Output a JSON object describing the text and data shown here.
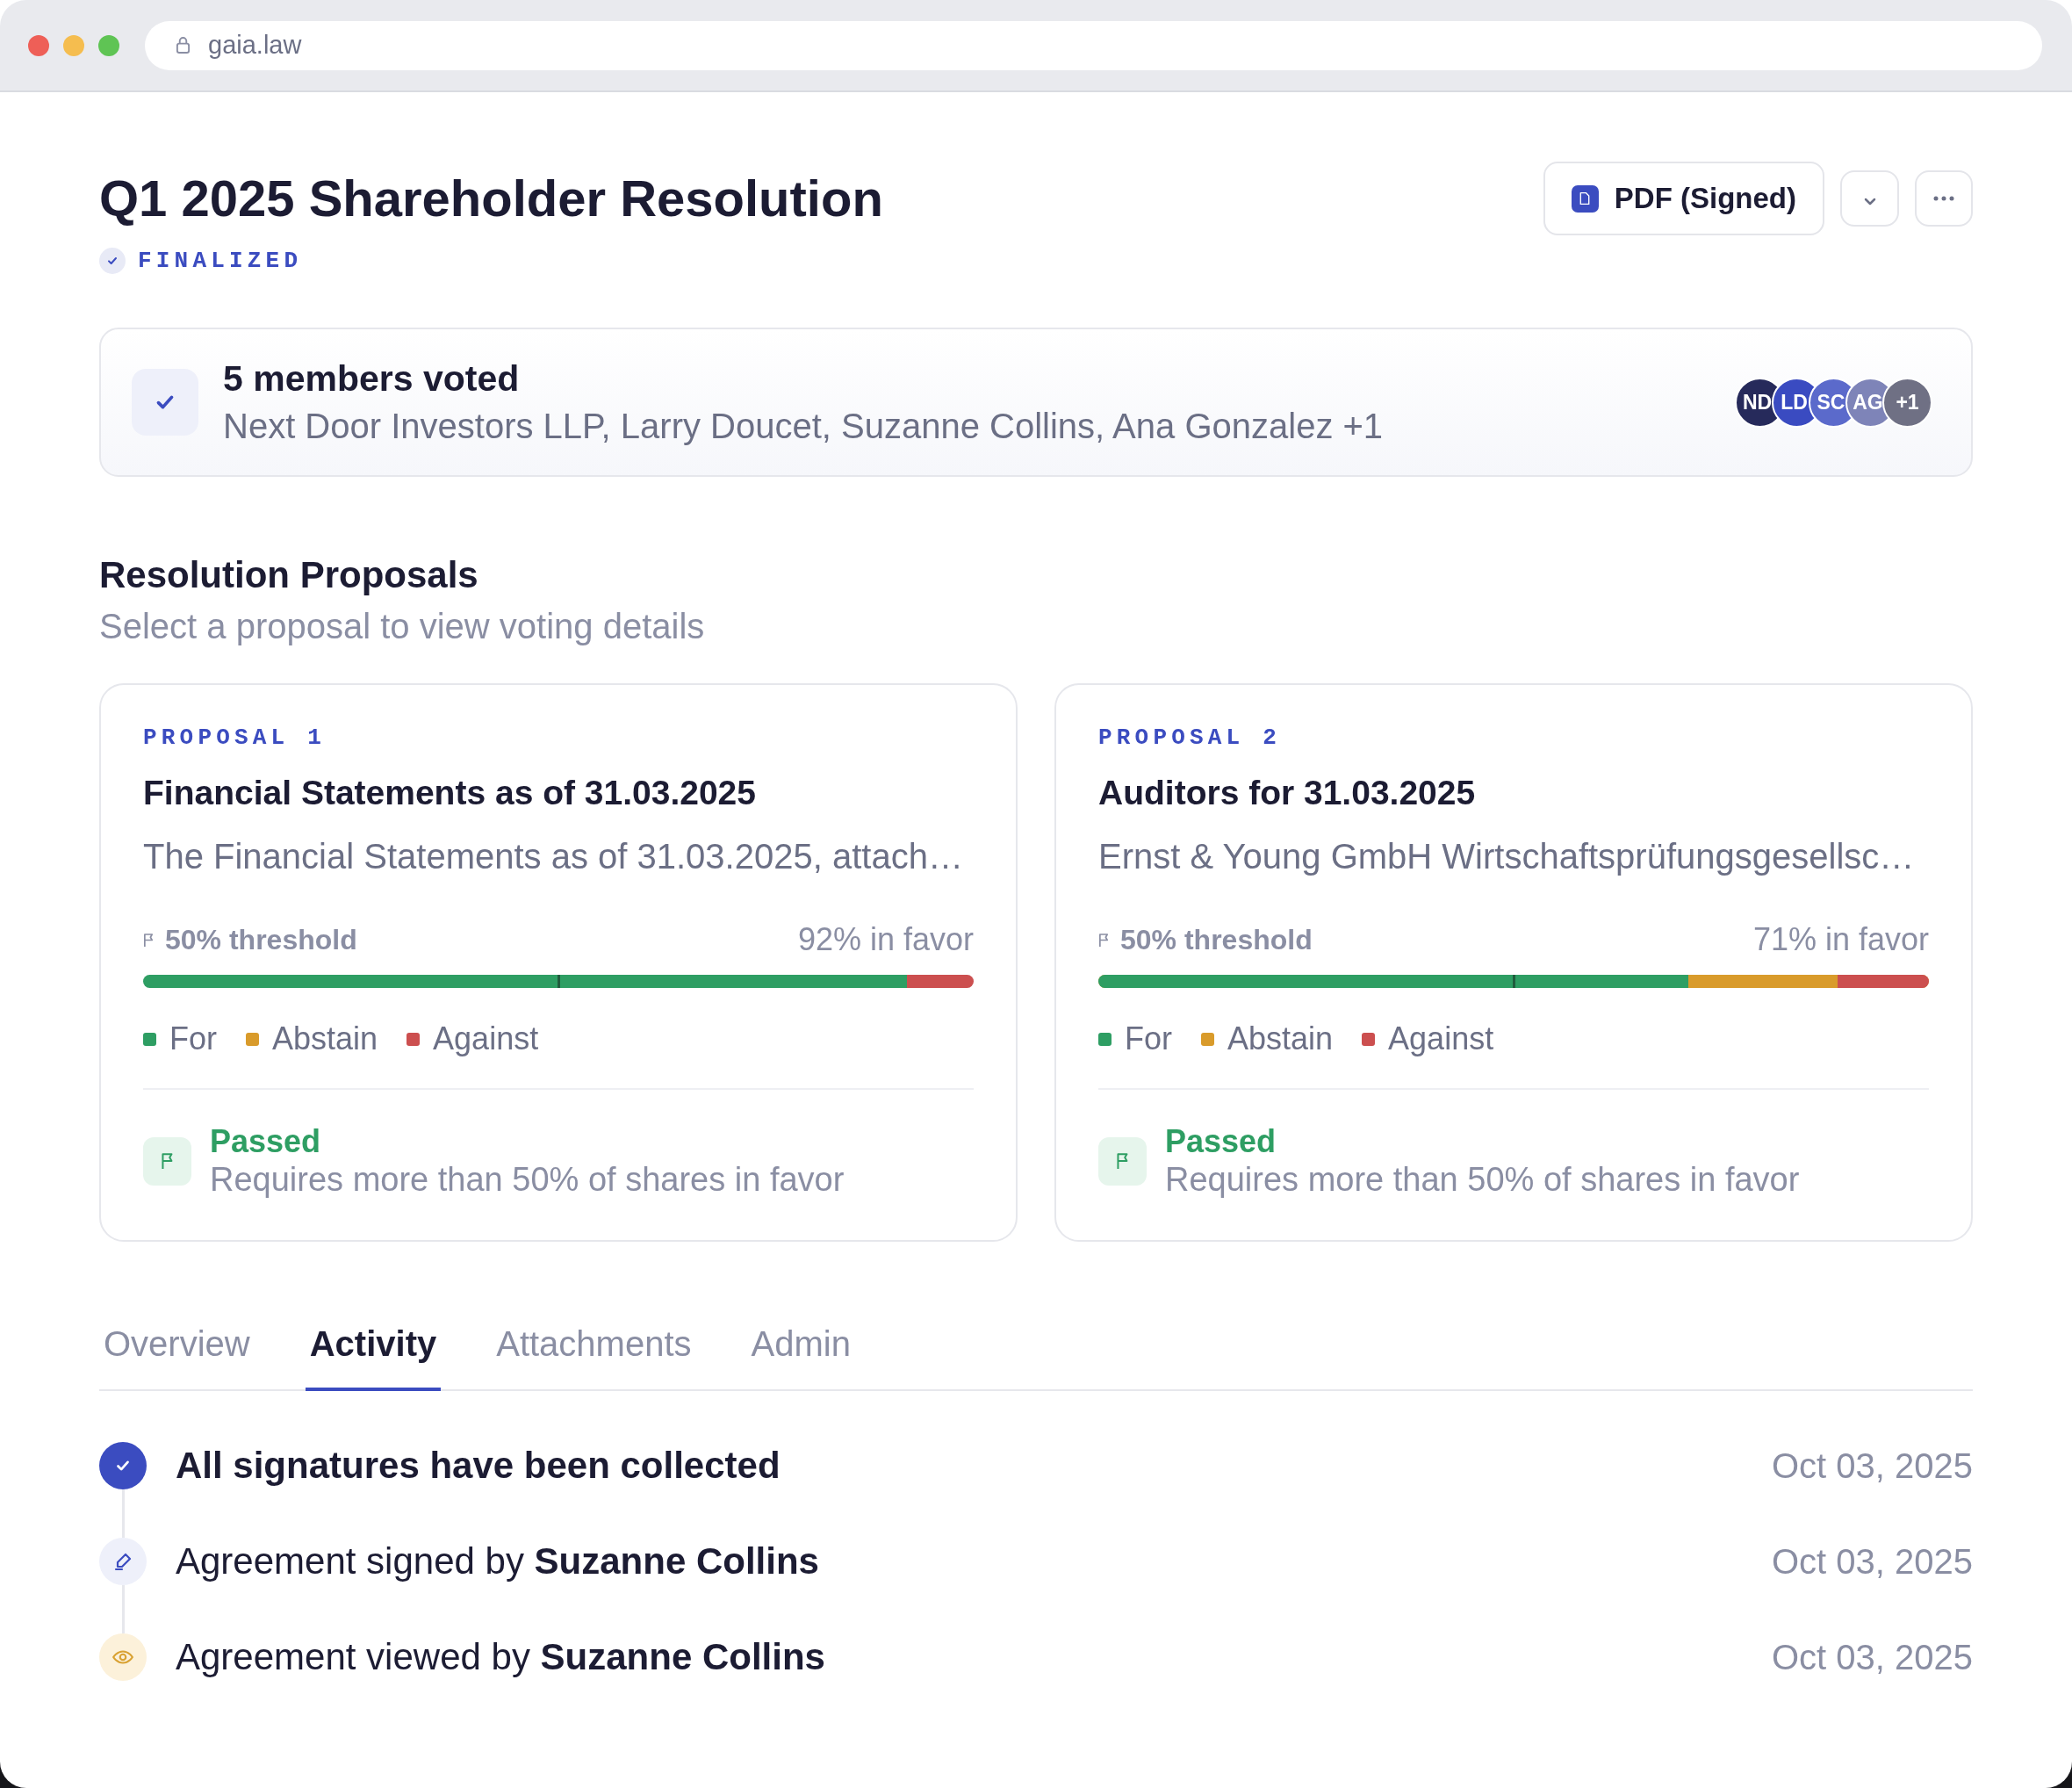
{
  "browser": {
    "url": "gaia.law"
  },
  "header": {
    "title": "Q1 2025 Shareholder Resolution",
    "status": "FINALIZED",
    "download_label": "PDF (Signed)"
  },
  "voters": {
    "title": "5 members voted",
    "names": "Next Door Investors LLP, Larry Doucet, Suzanne Collins, Ana Gonzalez +1",
    "avatars": [
      {
        "initials": "ND",
        "color": "#262a5b"
      },
      {
        "initials": "LD",
        "color": "#3a4bc1"
      },
      {
        "initials": "SC",
        "color": "#5b6acb"
      },
      {
        "initials": "AG",
        "color": "#7e84b8"
      },
      {
        "initials": "+1",
        "color": "#6f7084"
      }
    ]
  },
  "proposals_section": {
    "title": "Resolution Proposals",
    "subtitle": "Select a proposal to view voting details"
  },
  "proposals": [
    {
      "label": "PROPOSAL 1",
      "title": "Financial Statements as of 31.03.2025",
      "description": "The Financial Statements as of 31.03.2025, attach…",
      "selected": false,
      "threshold": {
        "label": "50% threshold",
        "level": 0.5
      },
      "favor_label": "92% in favor",
      "vote_bar": {
        "for": {
          "level": 0.92,
          "color": "#2e9e63"
        },
        "against": {
          "level": 0.08,
          "color": "#cc4f4f"
        }
      },
      "legend": [
        {
          "label": "For",
          "color": "#2e9e63"
        },
        {
          "label": "Abstain",
          "color": "#d99b2b"
        },
        {
          "label": "Against",
          "color": "#cc4f4f"
        }
      ],
      "result": {
        "label": "Passed",
        "note": "Requires more than 50% of shares in favor",
        "passed": true
      }
    },
    {
      "label": "PROPOSAL 2",
      "title": "Auditors for 31.03.2025",
      "description": "Ernst & Young GmbH Wirtschaftsprüfungsgesellsc…",
      "selected": false,
      "threshold": {
        "label": "50% threshold",
        "level": 0.5
      },
      "favor_label": "71% in favor",
      "vote_bar": {
        "for": {
          "level": 0.71,
          "color": "#2e9e63"
        },
        "abstain": {
          "color": "#d99b2b"
        },
        "against": {
          "level": 0.11,
          "color": "#cc4f4f"
        }
      },
      "legend": [
        {
          "label": "For",
          "color": "#2e9e63"
        },
        {
          "label": "Abstain",
          "color": "#d99b2b"
        },
        {
          "label": "Against",
          "color": "#cc4f4f"
        }
      ],
      "result": {
        "label": "Passed",
        "note": "Requires more than 50% of shares in favor",
        "passed": true
      }
    }
  ],
  "tabs": [
    {
      "label": "Overview",
      "selected": false
    },
    {
      "label": "Activity",
      "selected": true
    },
    {
      "label": "Attachments",
      "selected": false
    },
    {
      "label": "Admin",
      "selected": false
    }
  ],
  "activity": [
    {
      "kind": "completed",
      "text": "All signatures have been collected",
      "date": "Oct 03, 2025"
    },
    {
      "kind": "signed",
      "text": "Agreement signed by **Suzanne Collins**",
      "date": "Oct 03, 2025"
    },
    {
      "kind": "viewed",
      "text": "Agreement viewed by **Suzanne Collins**",
      "date": "Oct 03, 2025"
    }
  ]
}
